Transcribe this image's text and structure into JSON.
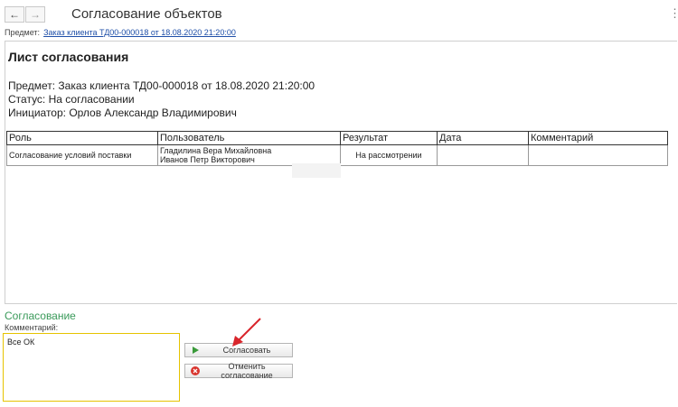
{
  "window": {
    "title": "Согласование объектов",
    "back_glyph": "←",
    "forward_glyph": "→",
    "more_glyph": "⋮"
  },
  "subject": {
    "label": "Предмет:",
    "link": "Заказ клиента ТД00-000018 от 18.08.2020 21:20:00"
  },
  "sheet": {
    "title": "Лист согласования",
    "subject_line": "Предмет: Заказ клиента ТД00-000018 от 18.08.2020 21:20:00",
    "status_line": "Статус: На согласовании",
    "initiator_line": "Инициатор: Орлов Александр Владимирович",
    "columns": [
      "Роль",
      "Пользователь",
      "Результат",
      "Дата",
      "Комментарий"
    ],
    "rows": [
      {
        "role": "Согласование условий поставки",
        "user1": "Гладилина Вера Михайловна",
        "user2": "Иванов Петр Викторович",
        "result": "На рассмотрении",
        "date": "",
        "comment": ""
      }
    ]
  },
  "approval": {
    "section_title": "Согласование",
    "comment_label": "Комментарий:",
    "comment_value": "Все ОК",
    "approve_label": "Согласовать",
    "cancel_label": "Отменить согласование",
    "approve_icon": "play-icon",
    "cancel_icon": "cancel-circle-icon",
    "accent_color": "#3a9a5a",
    "highlight_color": "#e6c300",
    "arrow_color": "#d9262c"
  }
}
